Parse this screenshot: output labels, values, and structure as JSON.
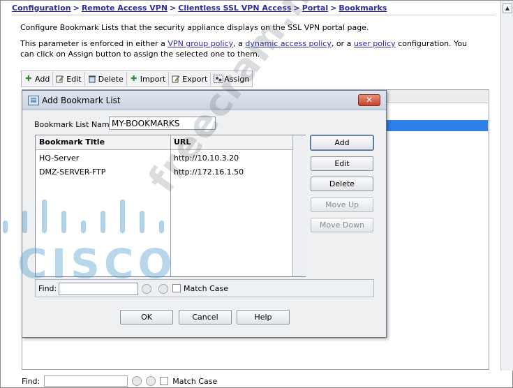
{
  "breadcrumb": {
    "items": [
      "Configuration",
      "Remote Access VPN",
      "Clientless SSL VPN Access",
      "Portal",
      "Bookmarks"
    ],
    "separator": ">"
  },
  "description": {
    "line1": "Configure Bookmark Lists that the security appliance displays on the SSL VPN portal page.",
    "line2_prefix": "This parameter is enforced in either a ",
    "link_vpn_group_policy": "VPN group policy",
    "sep_a": ", a ",
    "link_dynamic_access_policy": "dynamic access policy",
    "sep_b": ", or a ",
    "link_user_policy": "user policy",
    "line2_suffix": " configuration. You can click on Assign button to assign the selected one to them."
  },
  "toolbar": {
    "add": "Add",
    "edit": "Edit",
    "delete": "Delete",
    "import": "Import",
    "export": "Export",
    "assign": "Assign"
  },
  "background_find": {
    "label": "Find:",
    "match_case": "Match Case"
  },
  "dialog": {
    "title": "Add Bookmark List",
    "close_glyph": "✕",
    "name_label": "Bookmark List Name:",
    "name_value": "MY-BOOKMARKS",
    "table": {
      "columns": [
        "Bookmark Title",
        "URL"
      ],
      "rows": [
        {
          "title": "HQ-Server",
          "url": "http://10.10.3.20"
        },
        {
          "title": "DMZ-SERVER-FTP",
          "url": "http://172.16.1.50"
        }
      ]
    },
    "buttons": {
      "add": "Add",
      "edit": "Edit",
      "delete": "Delete",
      "move_up": "Move Up",
      "move_down": "Move Down"
    },
    "find": {
      "label": "Find:",
      "value": "",
      "match_case": "Match Case"
    },
    "footer": {
      "ok": "OK",
      "cancel": "Cancel",
      "help": "Help"
    }
  },
  "watermarks": {
    "brand": "CISCO",
    "site": "freecram.net"
  },
  "colors": {
    "link": "#2c2c9e",
    "selection": "#2f80e6",
    "close_button": "#c5432c",
    "cisco_watermark": "#4696c8"
  },
  "icons": {
    "add": "plus-icon",
    "edit": "edit-icon",
    "delete": "trash-icon",
    "import": "import-icon",
    "export": "export-icon",
    "assign": "assign-icon"
  }
}
